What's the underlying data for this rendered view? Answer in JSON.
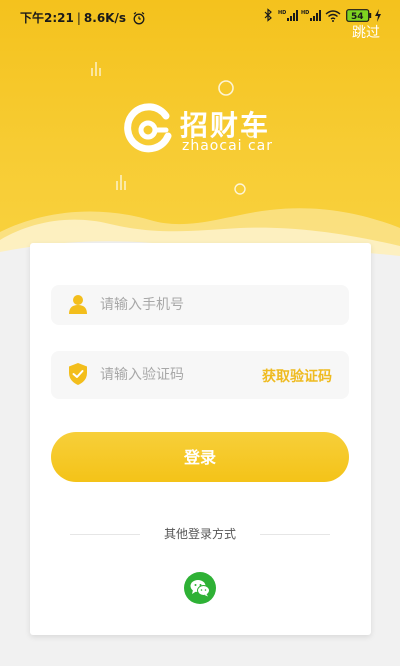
{
  "status_bar": {
    "time": "下午2:21",
    "separator": "|",
    "net_speed": "8.6K/s",
    "battery_level": "54"
  },
  "header": {
    "skip_label": "跳过",
    "brand_name": "招财车",
    "brand_subtitle": "zhaocai car"
  },
  "login_form": {
    "phone_placeholder": "请输入手机号",
    "code_placeholder": "请输入验证码",
    "get_code_label": "获取验证码",
    "login_button_label": "登录",
    "other_login_label": "其他登录方式"
  },
  "colors": {
    "accent": "#f4c21d",
    "code_link": "#efbb20",
    "wechat": "#2eb135",
    "battery": "#7ed321"
  }
}
